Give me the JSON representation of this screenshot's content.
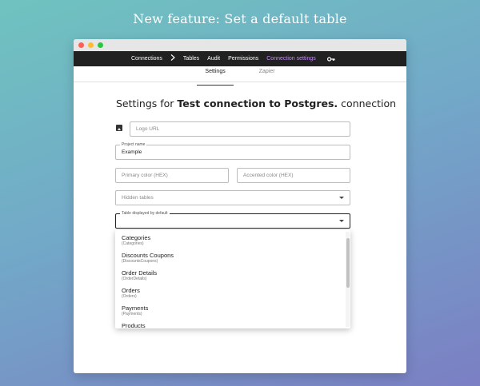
{
  "banner": {
    "title": "New feature: Set a default table"
  },
  "nav": {
    "items": [
      {
        "label": "Connections"
      },
      {
        "label": "Tables"
      },
      {
        "label": "Audit"
      },
      {
        "label": "Permissions"
      },
      {
        "label": "Connection settings"
      }
    ],
    "active": "Connection settings",
    "icons": {
      "separator": "chevron-right-icon",
      "key": "key-icon"
    }
  },
  "subtabs": [
    {
      "label": "Settings",
      "active": true
    },
    {
      "label": "Zapier",
      "active": false
    }
  ],
  "heading": {
    "prefix": "Settings for",
    "name": "Test connection to Postgres.",
    "suffix": "connection"
  },
  "form": {
    "logo_url": {
      "placeholder": "Logo URL",
      "value": ""
    },
    "project_name": {
      "label": "Project name",
      "value": "Example"
    },
    "primary_color": {
      "placeholder": "Primary color (HEX)",
      "value": ""
    },
    "accented_color": {
      "placeholder": "Accented color (HEX)",
      "value": ""
    },
    "hidden_tables": {
      "placeholder": "Hidden tables",
      "value": ""
    },
    "default_table": {
      "label": "Table displayed by default",
      "value": ""
    }
  },
  "dropdown_options": [
    {
      "name": "Categories",
      "sub": "(Categories)"
    },
    {
      "name": "Discounts Coupons",
      "sub": "(DiscountsCoupons)"
    },
    {
      "name": "Order Details",
      "sub": "(OrderDetails)"
    },
    {
      "name": "Orders",
      "sub": "(Orders)"
    },
    {
      "name": "Payments",
      "sub": "(Payments)"
    },
    {
      "name": "Products",
      "sub": ""
    }
  ],
  "colors": {
    "navbar": "#212121",
    "active_nav": "#c58af9",
    "accent_text": "#222222"
  }
}
